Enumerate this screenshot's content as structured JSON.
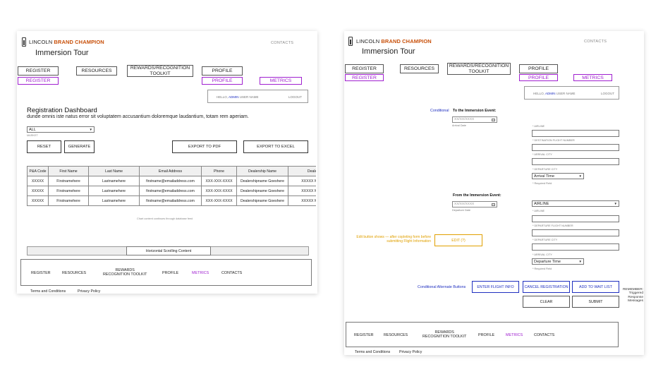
{
  "brand": {
    "prefix": "LINCOLN",
    "suffix": "BRAND CHAMPION"
  },
  "page_title": "Immersion Tour",
  "contacts_link": "CONTACTS",
  "nav": {
    "register": "REGISTER",
    "resources": "RESOURCES",
    "toolkit": "REWARDS/RECOGNITION TOOLKIT",
    "profile": "PROFILE",
    "register_alt": "REGISTER",
    "profile_alt": "PROFILE",
    "metrics": "METRICS"
  },
  "hello": {
    "hello": "HELLO,",
    "admin": "ADMIN",
    "user_name": "USER NAME",
    "logout": "LOGOUT"
  },
  "dashboard": {
    "title": "Registration Dashboard",
    "subtitle": "dunde omnis iste natus error sit voluptatem accusantium doloremque laudantium, totam rem aperiam.",
    "market_value": "ALL",
    "market_label": "MARKET",
    "reset": "RESET",
    "generate": "GENERATE",
    "export_pdf": "EXPORT TO PDF",
    "export_excel": "EXPORT TO EXCEL",
    "table": {
      "headers": [
        "P&A Code",
        "First Name",
        "Last Name",
        "Email Address",
        "Phone",
        "Dealership Name",
        "Dealer"
      ],
      "rows": [
        [
          "XXXXX",
          "Firstnamehere",
          "Lastnamehere",
          "firstname@emailaddress.com",
          "XXX-XXX-XXXX",
          "Dealershipname Goeshere",
          "XXXXX Mains"
        ],
        [
          "XXXXX",
          "Firstnamehere",
          "Lastnamehere",
          "firstname@emailaddress.com",
          "XXX-XXX-XXXX",
          "Dealershipname Goeshere",
          "XXXXX Mains"
        ],
        [
          "XXXXX",
          "Firstnamehere",
          "Lastnamehere",
          "firstname@emailaddress.com",
          "XXX-XXX-XXXX",
          "Dealershipname Goeshere",
          "XXXXX Mains"
        ]
      ]
    },
    "chart_note": "Chart content continues through database feed",
    "scroll_label": "Horizontal Scrolling Content"
  },
  "footer": {
    "register": "REGISTER",
    "resources": "RESOURCES",
    "toolkit_line1": "REWARDS",
    "toolkit_line2": "RECOGNITION TOOLKIT",
    "profile": "PROFILE",
    "metrics": "METRICS",
    "contacts": "CONTACTS",
    "terms": "Terms and Conditions",
    "privacy": "Privacy Policy"
  },
  "flight": {
    "conditional": "Conditional",
    "to_event": "To the Immersion Event:",
    "arrival_date_value": "XX/XX/XXXX",
    "arrival_date_label": "Arrival Date",
    "airline_label": "* AIRLINE",
    "dest_flight_label": "* DESTINATION FLIGHT NUMBER",
    "arrival_city_label": "* ARRIVAL CITY",
    "departure_city_label": "* DEPARTURE CITY",
    "arrival_time_value": "Arrival Time",
    "required": "* Required Field",
    "from_event": "From the Immersion Event:",
    "departure_date_value": "XX/XX/XXXX",
    "departure_date_label": "Departure Date",
    "airline_select": "AIRLINE",
    "airline_label2": "* AIRLINE",
    "departure_flight_label": "* DEPARTURE FLIGHT NUMBER",
    "departure_city_label2": "* DEPARTURE CITY",
    "arrival_city_label2": "* ARRIVAL CITY",
    "departure_time_value": "Departure Time",
    "required2": "* Required Field",
    "edit_note_line1": "Edit button shows — after copleting form before",
    "edit_note_line2": "submitting Flight Information",
    "edit_button": "EDIT (?)",
    "cond_alt_buttons": "Conditional Alternate Buttons",
    "enter_flight_info": "ENTER FLIGHT INFO",
    "cancel_registration": "CANCEL REGISTRATION",
    "add_wait_list": "ADD TO WAIT LIST",
    "clear": "CLEAR",
    "submit": "SUBMIT",
    "remember": [
      "REMEMBER:",
      "Triggered",
      "Response",
      "Messages"
    ]
  },
  "colors": {
    "accent_orange": "#c8500a",
    "purple": "#a020d0",
    "blue": "#2030c0",
    "yellow": "#e0a000"
  }
}
